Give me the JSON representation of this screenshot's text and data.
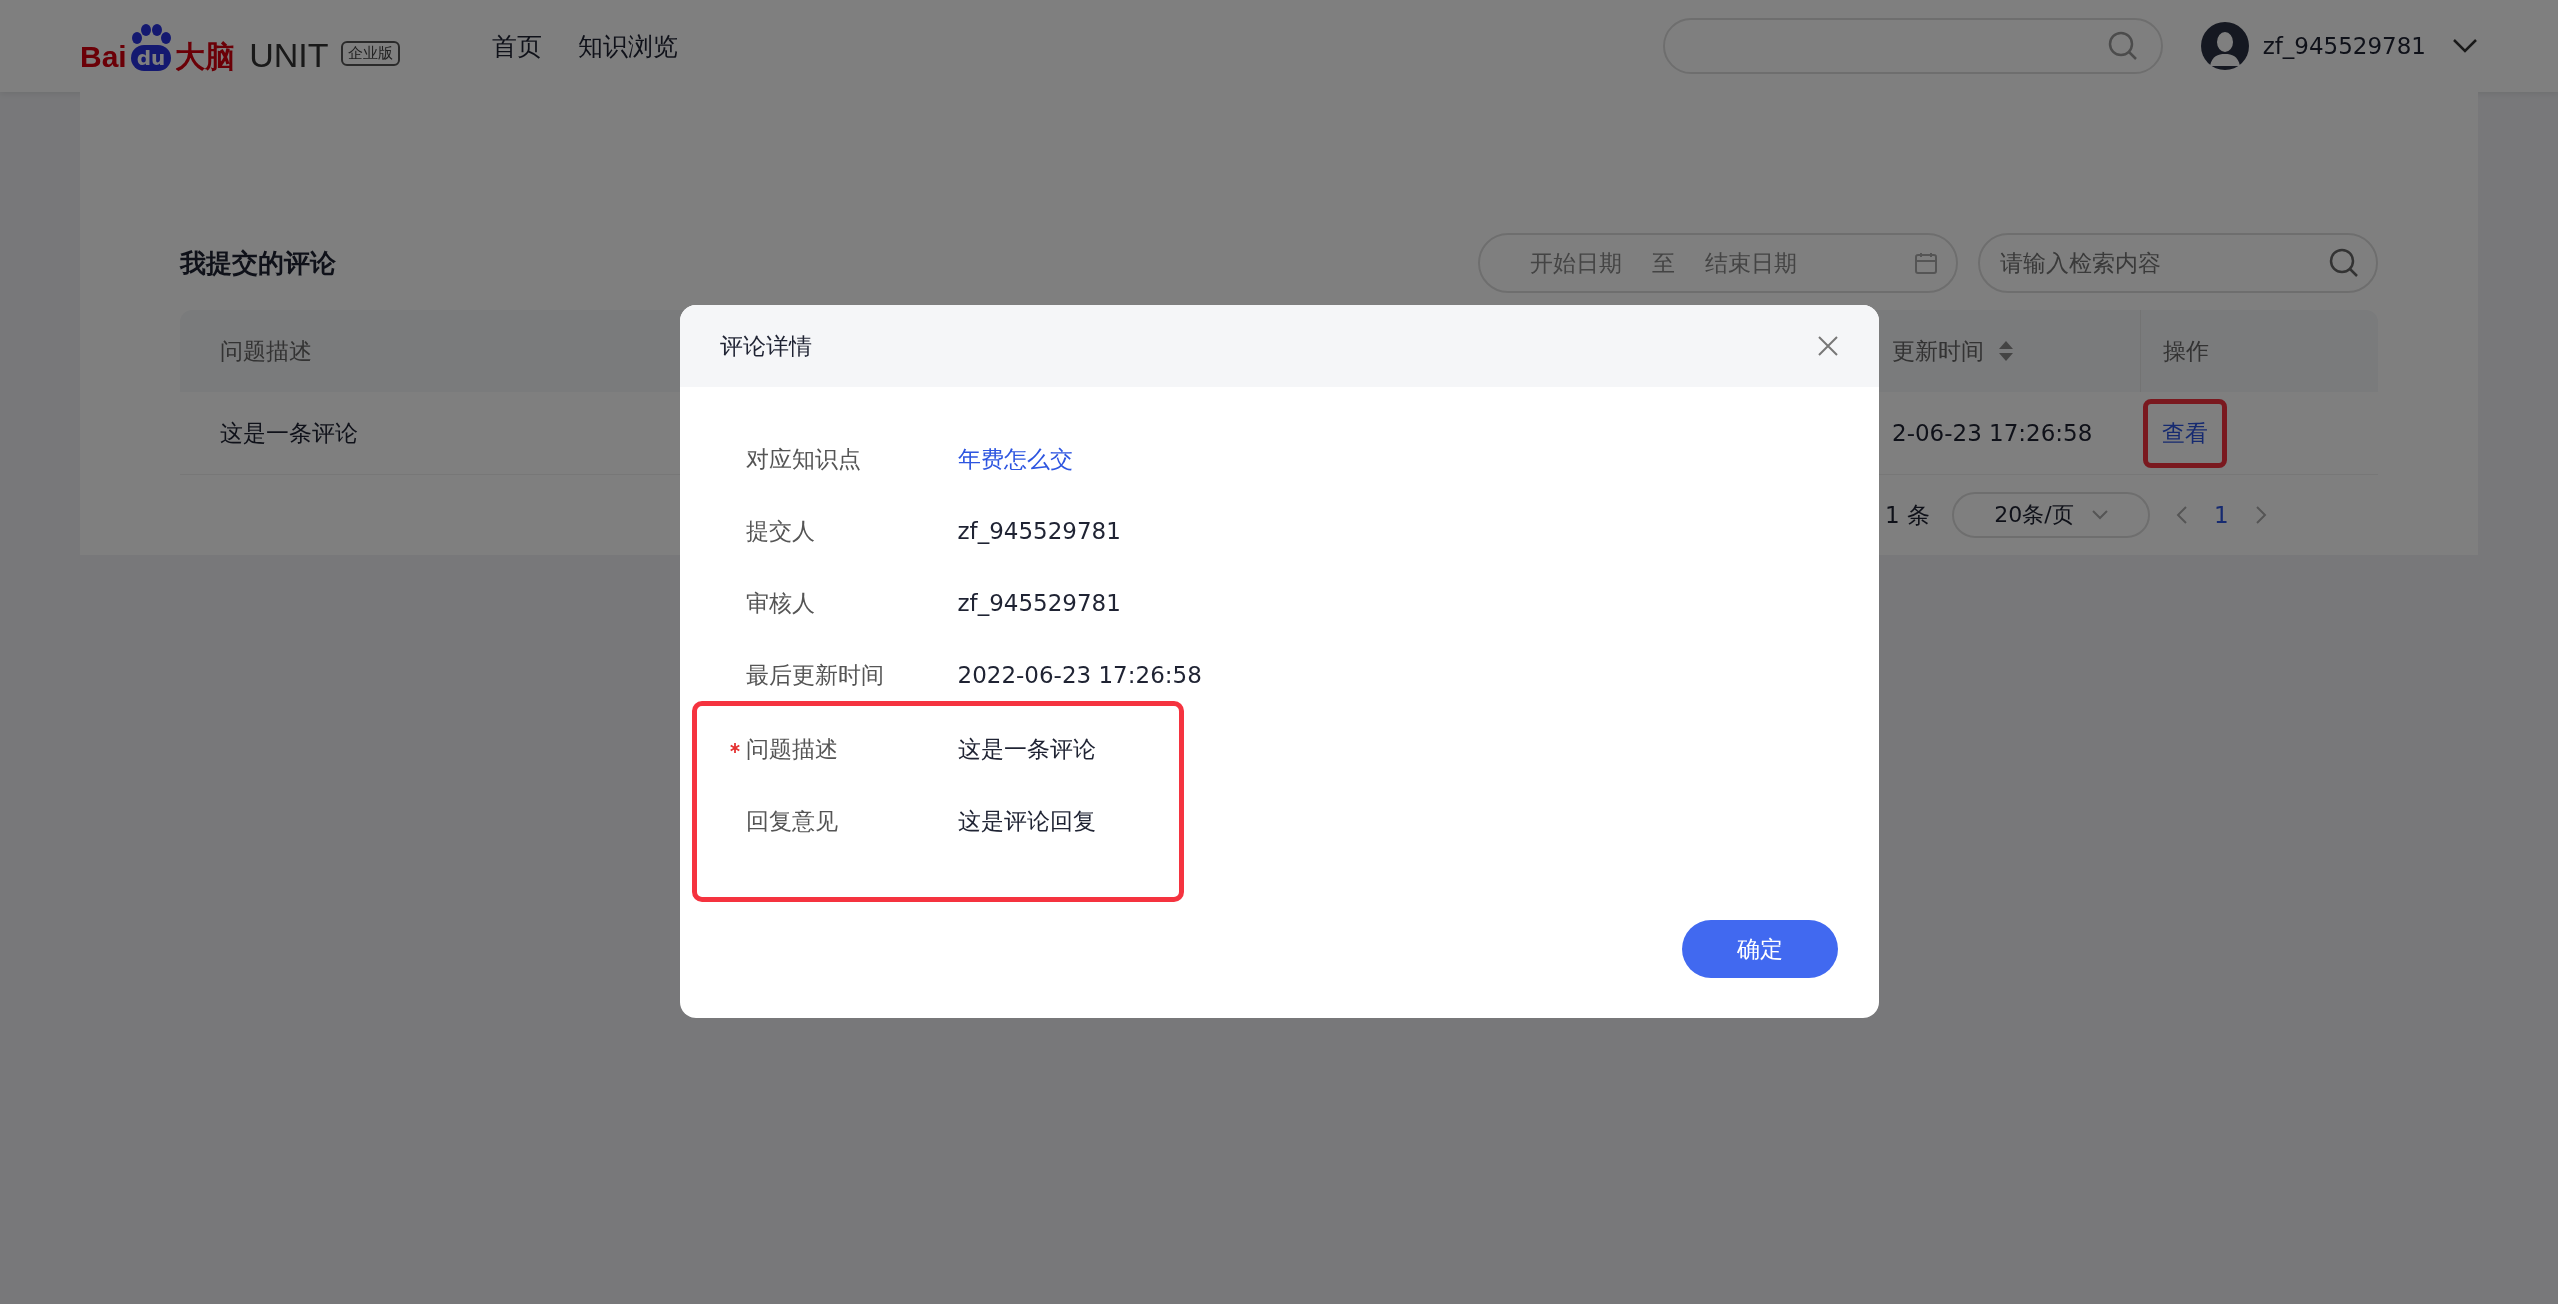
{
  "header": {
    "logo": {
      "brand_left": "Bai",
      "brand_paw": "du",
      "brand_right": "大脑",
      "product": "UNIT",
      "edition": "企业版"
    },
    "nav": [
      {
        "label": "首页"
      },
      {
        "label": "知识浏览"
      }
    ],
    "user": {
      "name": "zf_945529781"
    }
  },
  "page": {
    "title": "我提交的评论",
    "date_range": {
      "start_placeholder": "开始日期",
      "separator": "至",
      "end_placeholder": "结束日期"
    },
    "search": {
      "placeholder": "请输入检索内容"
    },
    "table": {
      "columns": [
        {
          "label": "问题描述",
          "sortable": false
        },
        {
          "label": "更新时间",
          "sortable": true
        },
        {
          "label": "操作",
          "sortable": false
        }
      ],
      "rows": [
        {
          "cells": [
            "这是一条评论",
            "2-06-23 17:26:58"
          ],
          "action": {
            "label": "查看",
            "highlighted": true
          }
        }
      ]
    },
    "pagination": {
      "total": "1 条",
      "page_size": "20条/页",
      "pages": [
        {
          "label": "1",
          "selected": true
        }
      ]
    }
  },
  "dialog": {
    "title": "评论详情",
    "fields": [
      {
        "label": "对应知识点",
        "value": "年费怎么交",
        "kind": "link",
        "required": false,
        "highlighted": false
      },
      {
        "label": "提交人",
        "value": "zf_945529781",
        "kind": "text",
        "required": false,
        "highlighted": false
      },
      {
        "label": "审核人",
        "value": "zf_945529781",
        "kind": "text",
        "required": false,
        "highlighted": false
      },
      {
        "label": "最后更新时间",
        "value": "2022-06-23 17:26:58",
        "kind": "text",
        "required": false,
        "highlighted": false
      },
      {
        "label": "问题描述",
        "value": "这是一条评论",
        "kind": "text",
        "required": true,
        "highlighted": true
      },
      {
        "label": "回复意见",
        "value": "这是评论回复",
        "kind": "text",
        "required": false,
        "highlighted": true
      }
    ],
    "confirm": "确定"
  }
}
